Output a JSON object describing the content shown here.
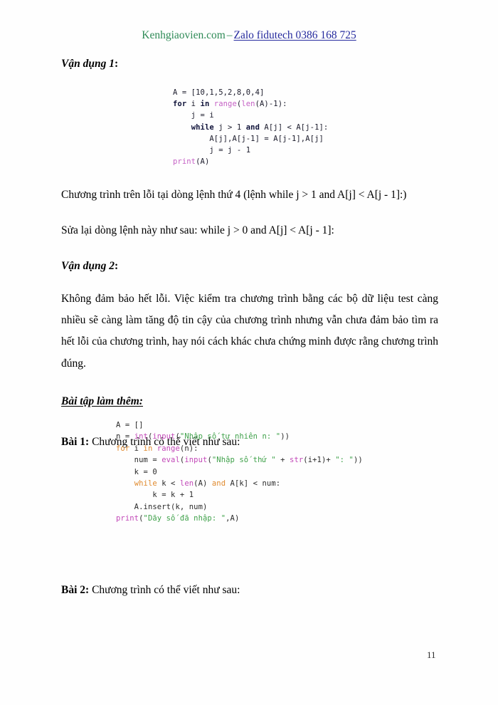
{
  "header": {
    "brand": "Kenhgiaovien.com",
    "separator": "–",
    "zalo_link": "Zalo fidutech 0386 168 725",
    "brand_color": "#2f8b57",
    "link_color": "#252a9e"
  },
  "sections": {
    "vandung1_heading": "Vận dụng 1",
    "vandung1_colon": ":",
    "vandung2_heading": "Vận dụng 2",
    "vandung2_colon": ":",
    "baitap_heading": "Bài tập làm thêm:"
  },
  "code_block_1": {
    "lines": [
      [
        {
          "t": "A = [10,1,5,2,8,0,4]",
          "c": "txt"
        }
      ],
      [
        {
          "t": "for",
          "c": "kw"
        },
        {
          "t": " i ",
          "c": "txt"
        },
        {
          "t": "in",
          "c": "kw"
        },
        {
          "t": " ",
          "c": "txt"
        },
        {
          "t": "range",
          "c": "fn"
        },
        {
          "t": "(",
          "c": "txt"
        },
        {
          "t": "len",
          "c": "fn"
        },
        {
          "t": "(A)-1):",
          "c": "txt"
        }
      ],
      [
        {
          "t": "    j = i",
          "c": "txt"
        }
      ],
      [
        {
          "t": "    ",
          "c": "txt"
        },
        {
          "t": "while",
          "c": "kw"
        },
        {
          "t": " j > 1 ",
          "c": "txt"
        },
        {
          "t": "and",
          "c": "kw"
        },
        {
          "t": " A[j] < A[j-1]:",
          "c": "txt"
        }
      ],
      [
        {
          "t": "        A[j],A[j-1] = A[j-1],A[j]",
          "c": "txt"
        }
      ],
      [
        {
          "t": "        j = j - 1",
          "c": "txt"
        }
      ],
      [
        {
          "t": "print",
          "c": "fn"
        },
        {
          "t": "(A)",
          "c": "txt"
        }
      ]
    ]
  },
  "code_block_2": {
    "lines": [
      [
        {
          "t": "A = []",
          "c": "txt"
        }
      ],
      [
        {
          "t": "n = ",
          "c": "txt"
        },
        {
          "t": "int",
          "c": "fn"
        },
        {
          "t": "(",
          "c": "txt"
        },
        {
          "t": "input",
          "c": "fn"
        },
        {
          "t": "(",
          "c": "txt"
        },
        {
          "t": "\"Nhập số tự nhiên n: \"",
          "c": "str"
        },
        {
          "t": "))",
          "c": "txt"
        }
      ],
      [
        {
          "t": "for",
          "c": "kw"
        },
        {
          "t": " i ",
          "c": "txt"
        },
        {
          "t": "in",
          "c": "kw"
        },
        {
          "t": " ",
          "c": "txt"
        },
        {
          "t": "range",
          "c": "fn"
        },
        {
          "t": "(n):",
          "c": "txt"
        }
      ],
      [
        {
          "t": "    num = ",
          "c": "txt"
        },
        {
          "t": "eval",
          "c": "fn"
        },
        {
          "t": "(",
          "c": "txt"
        },
        {
          "t": "input",
          "c": "fn"
        },
        {
          "t": "(",
          "c": "txt"
        },
        {
          "t": "\"Nhập số thứ \"",
          "c": "str"
        },
        {
          "t": " + ",
          "c": "txt"
        },
        {
          "t": "str",
          "c": "fn"
        },
        {
          "t": "(i+1)+ ",
          "c": "txt"
        },
        {
          "t": "\": \"",
          "c": "str"
        },
        {
          "t": "))",
          "c": "txt"
        }
      ],
      [
        {
          "t": "    k = 0",
          "c": "txt"
        }
      ],
      [
        {
          "t": "    ",
          "c": "txt"
        },
        {
          "t": "while",
          "c": "kw"
        },
        {
          "t": " k < ",
          "c": "txt"
        },
        {
          "t": "len",
          "c": "fn"
        },
        {
          "t": "(A) ",
          "c": "txt"
        },
        {
          "t": "and",
          "c": "kw"
        },
        {
          "t": " A[k] < num:",
          "c": "txt"
        }
      ],
      [
        {
          "t": "        k = k + 1",
          "c": "txt"
        }
      ],
      [
        {
          "t": "    A.insert(k, num)",
          "c": "txt"
        }
      ],
      [
        {
          "t": "print",
          "c": "fn"
        },
        {
          "t": "(",
          "c": "txt"
        },
        {
          "t": "\"Dãy số đã nhập: \"",
          "c": "str"
        },
        {
          "t": ",A)",
          "c": "txt"
        }
      ]
    ]
  },
  "paragraphs": {
    "error_line": "Chương trình trên lỗi tại dòng lệnh thứ 4 (lệnh while j > 1 and A[j] < A[j - 1]:)",
    "fix_line": "Sửa lại dòng lệnh này như sau: while j > 0 and A[j] < A[j - 1]:",
    "vandung2_body": "Không đảm bảo hết lỗi. Việc kiểm tra chương trình bằng các bộ dữ liệu test càng nhiều sẽ càng làm tăng độ tin cậy của chương trình nhưng vẫn chưa đảm bảo tìm ra hết lỗi của chương trình, hay nói cách khác chưa chứng minh được rằng chương trình đúng."
  },
  "exercises": {
    "bai1_label": "Bài 1:",
    "bai1_text": " Chương trình có thể viết như sau:",
    "bai2_label": "Bài 2:",
    "bai2_text": " Chương trình có thể viết như sau:"
  },
  "footer": {
    "page_number": "11"
  }
}
